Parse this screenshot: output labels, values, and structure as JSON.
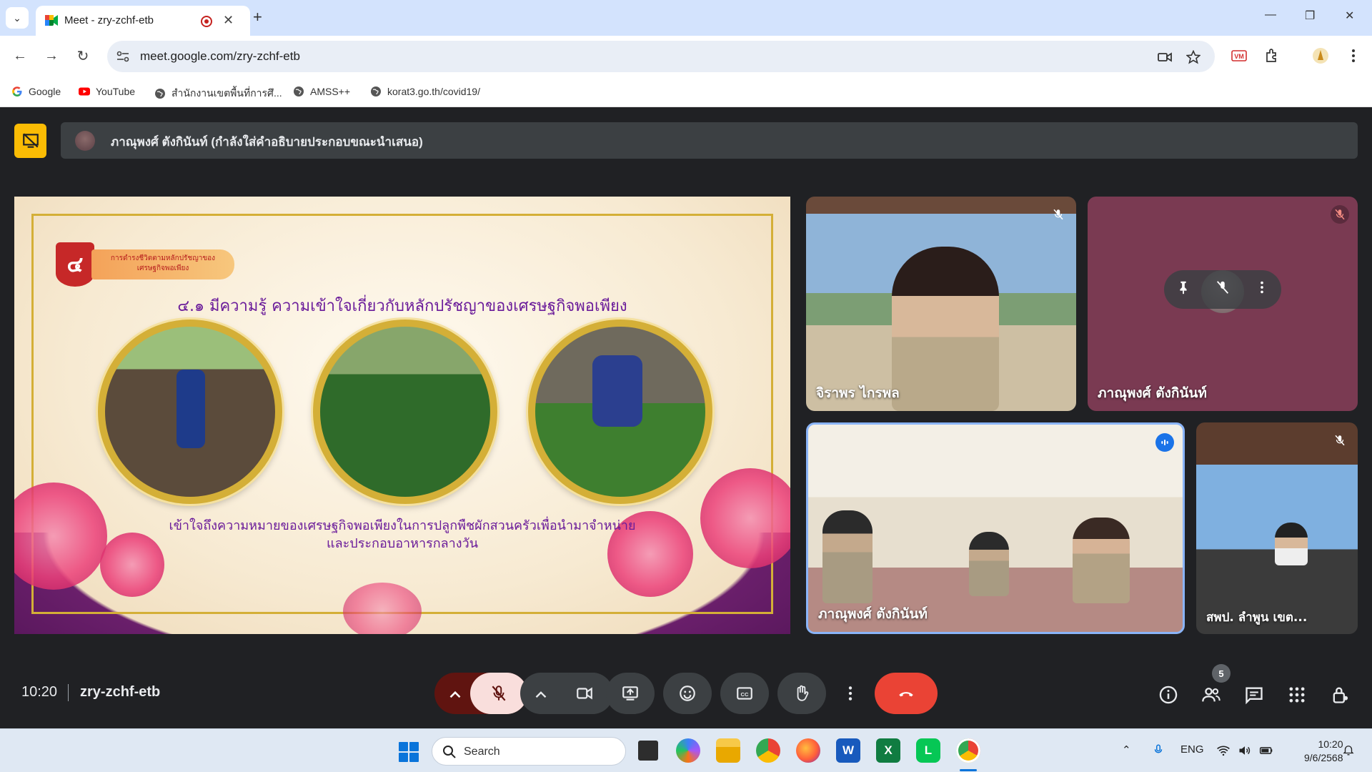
{
  "browser": {
    "tab_title": "Meet - zry-zchf-etb",
    "url": "meet.google.com/zry-zchf-etb",
    "bookmarks": [
      {
        "label": "Google",
        "icon": "google-icon"
      },
      {
        "label": "YouTube",
        "icon": "youtube-icon"
      },
      {
        "label": "สำนักงานเขตพื้นที่การศึ...",
        "icon": "globe-icon"
      },
      {
        "label": "AMSS++",
        "icon": "globe-icon"
      },
      {
        "label": "korat3.go.th/covid19/",
        "icon": "globe-icon"
      }
    ],
    "colors": {
      "tabstrip": "#d3e3fd",
      "omnibox": "#e9eef6"
    }
  },
  "meet": {
    "presenting_banner": "ภาณุพงศ์ ตังกินันท์ (กำลังใส่คำอธิบายประกอบขณะนำเสนอ)",
    "slide": {
      "badge_number": "๔",
      "badge_label_line1": "การดำรงชีวิตตามหลักปรัชญาของ",
      "badge_label_line2": "เศรษฐกิจพอเพียง",
      "heading": "๔.๑ มีความรู้ ความเข้าใจเกี่ยวกับหลักปรัชญาของเศรษฐกิจพอเพียง",
      "caption_line1": "เข้าใจถึงความหมายของเศรษฐกิจพอเพียงในการปลูกพืชผักสวนครัวเพื่อนำมาจำหน่าย",
      "caption_line2": "และประกอบอาหารกลางวัน"
    },
    "participants": [
      {
        "name": "จิราพร ไกรพล",
        "muted": true
      },
      {
        "name": "ภาณุพงศ์ ตังกินันท์",
        "muted": true
      },
      {
        "name": "ภาณุพงศ์ ตังกินันท์",
        "speaking": true
      },
      {
        "name": "สพป. ลำพูน เขต...",
        "muted": true
      }
    ],
    "time": "10:20",
    "meeting_code": "zry-zchf-etb",
    "people_count": "5",
    "colors": {
      "end_call": "#ea4335",
      "mic_off_bg": "#f9dedc",
      "accent": "#8ab4f8"
    }
  },
  "taskbar": {
    "search_placeholder": "Search",
    "language": "ENG",
    "time": "10:20",
    "date": "9/6/2568"
  }
}
